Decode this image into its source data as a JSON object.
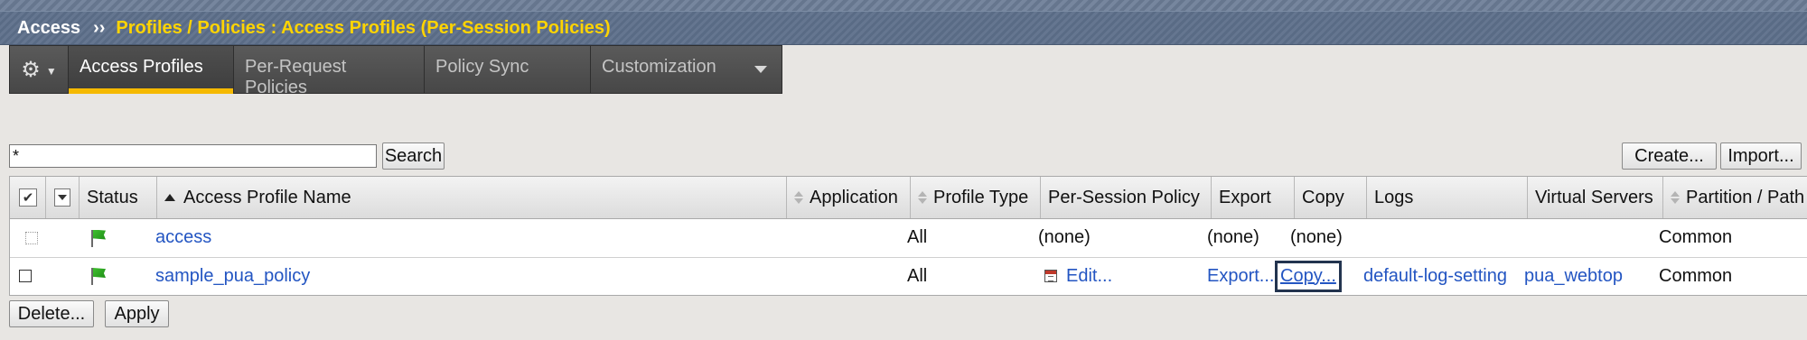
{
  "breadcrumb": {
    "root": "Access",
    "separator": "››",
    "path": "Profiles / Policies : Access Profiles (Per-Session Policies)"
  },
  "tabs": [
    {
      "label": "Access Profiles",
      "active": true
    },
    {
      "label": "Per-Request Policies",
      "active": false
    },
    {
      "label": "Policy Sync",
      "active": false
    },
    {
      "label": "Customization",
      "active": false
    }
  ],
  "search": {
    "value": "*",
    "button": "Search"
  },
  "actions": {
    "create": "Create...",
    "import": "Import...",
    "delete": "Delete...",
    "apply": "Apply"
  },
  "table": {
    "header_check": "✔",
    "columns": {
      "status": "Status",
      "name": "Access Profile Name",
      "application": "Application",
      "profile_type": "Profile Type",
      "policy": "Per-Session Policy",
      "export": "Export",
      "copy": "Copy",
      "logs": "Logs",
      "virtual_servers": "Virtual Servers",
      "partition": "Partition / Path"
    },
    "rows": [
      {
        "name": "access",
        "application": "",
        "profile_type": "All",
        "policy": "(none)",
        "export": "(none)",
        "copy": "(none)",
        "logs": "",
        "virtual_servers": "",
        "partition": "Common"
      },
      {
        "name": "sample_pua_policy",
        "application": "",
        "profile_type": "All",
        "policy": "Edit...",
        "export": "Export...",
        "copy": "Copy...",
        "logs": "default-log-setting",
        "virtual_servers": "pua_webtop",
        "partition": "Common"
      }
    ]
  },
  "colors": {
    "accent": "#f5b900",
    "title_bar": "#5d6f8a",
    "path_text": "#ffd400",
    "link": "#2355c2",
    "status_available": "#2fa822"
  },
  "icons": {
    "settings": "gear-icon",
    "status": "green-flag-icon",
    "edit": "policy-edit-icon"
  }
}
